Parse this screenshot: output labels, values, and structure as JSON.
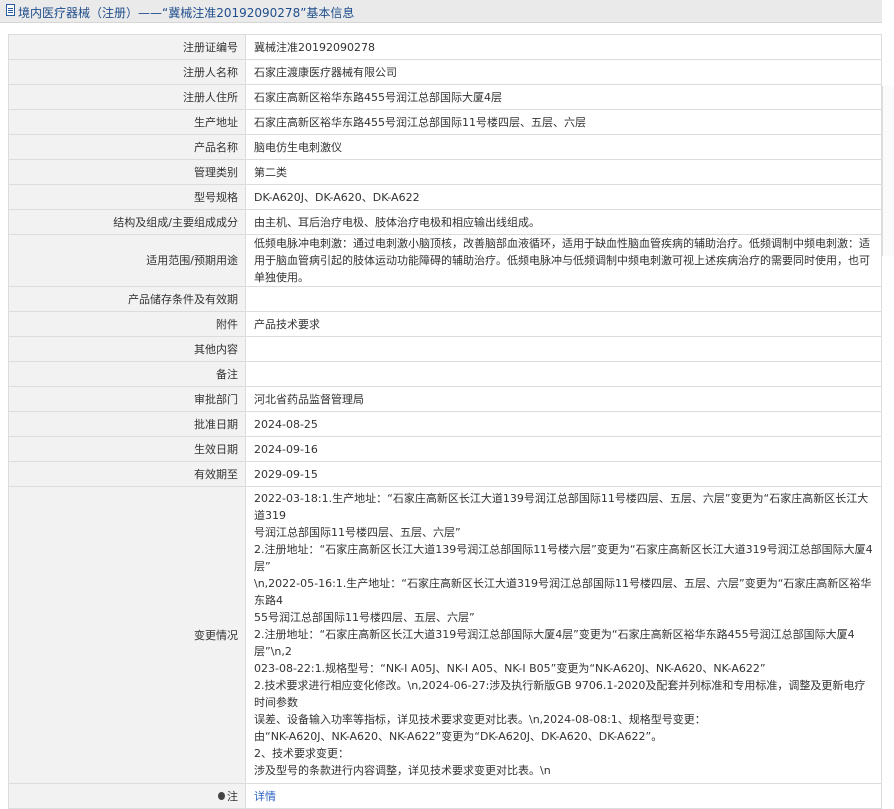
{
  "header": {
    "title": "境内医疗器械（注册）——“冀械注准20192090278”基本信息"
  },
  "rows": [
    {
      "label": "注册证编号",
      "value": "冀械注准20192090278"
    },
    {
      "label": "注册人名称",
      "value": "石家庄渡康医疗器械有限公司"
    },
    {
      "label": "注册人住所",
      "value": "石家庄高新区裕华东路455号润江总部国际大厦4层"
    },
    {
      "label": "生产地址",
      "value": "石家庄高新区裕华东路455号润江总部国际11号楼四层、五层、六层"
    },
    {
      "label": "产品名称",
      "value": "脑电仿生电刺激仪"
    },
    {
      "label": "管理类别",
      "value": "第二类"
    },
    {
      "label": "型号规格",
      "value": "DK-A620J、DK-A620、DK-A622"
    },
    {
      "label": "结构及组成/主要组成成分",
      "value": "由主机、耳后治疗电极、肢体治疗电极和相应输出线组成。"
    },
    {
      "label": "适用范围/预期用途",
      "value": "低频电脉冲电刺激：通过电刺激小脑顶核，改善脑部血液循环，适用于缺血性脑血管疾病的辅助治疗。低频调制中频电刺激：适用于脑血管病引起的肢体运动功能障碍的辅助治疗。低频电脉冲与低频调制中频电刺激可视上述疾病治疗的需要同时使用，也可单独使用。"
    },
    {
      "label": "产品储存条件及有效期",
      "value": ""
    },
    {
      "label": "附件",
      "value": "产品技术要求"
    },
    {
      "label": "其他内容",
      "value": ""
    },
    {
      "label": "备注",
      "value": ""
    },
    {
      "label": "审批部门",
      "value": "河北省药品监督管理局"
    },
    {
      "label": "批准日期",
      "value": "2024-08-25"
    },
    {
      "label": "生效日期",
      "value": "2024-09-16"
    },
    {
      "label": "有效期至",
      "value": "2029-09-15"
    }
  ],
  "change": {
    "label": "变更情况",
    "lines": [
      "2022-03-18:1.生产地址：“石家庄高新区长江大道139号润江总部国际11号楼四层、五层、六层”变更为“石家庄高新区长江大道319",
      "号润江总部国际11号楼四层、五层、六层”",
      "2.注册地址：“石家庄高新区长江大道139号润江总部国际11号楼六层”变更为“石家庄高新区长江大道319号润江总部国际大厦4层”",
      "\\n,2022-05-16:1.生产地址：“石家庄高新区长江大道319号润江总部国际11号楼四层、五层、六层”变更为“石家庄高新区裕华东路4",
      "55号润江总部国际11号楼四层、五层、六层”",
      "2.注册地址：“石家庄高新区长江大道319号润江总部国际大厦4层”变更为“石家庄高新区裕华东路455号润江总部国际大厦4层”\\n,2",
      "023-08-22:1.规格型号：“NK-I A05J、NK-I A05、NK-I B05”变更为“NK-A620J、NK-A620、NK-A622”",
      "2.技术要求进行相应变化修改。\\n,2024-06-27:涉及执行新版GB 9706.1-2020及配套并列标准和专用标准，调整及更新电疗时间参数",
      "误差、设备输入功率等指标，详见技术要求变更对比表。\\n,2024-08-08:1、规格型号变更：",
      "由“NK-A620J、NK-A620、NK-A622”变更为“DK-A620J、DK-A620、DK-A622”。",
      "2、技术要求变更：",
      "涉及型号的条款进行内容调整，详见技术要求变更对比表。\\n"
    ]
  },
  "note": {
    "label": "注",
    "link_text": "详情"
  }
}
